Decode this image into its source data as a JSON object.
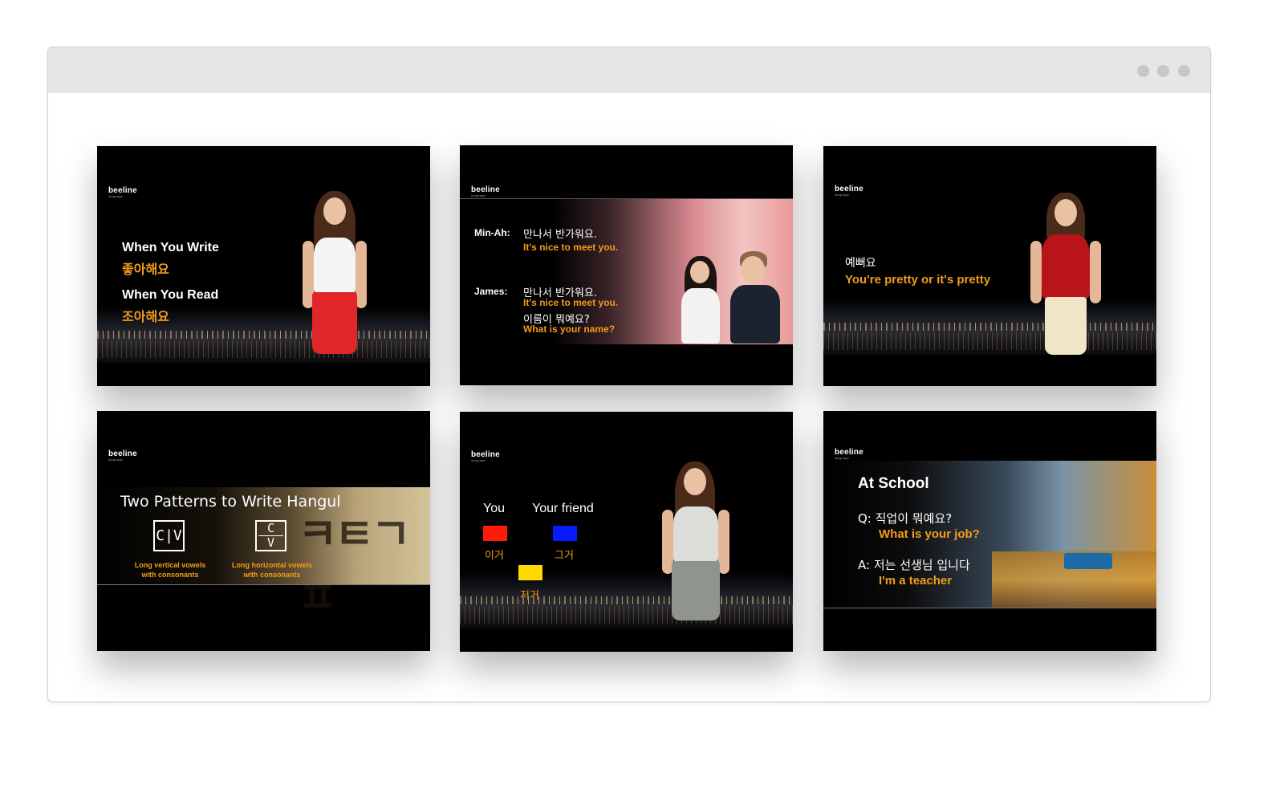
{
  "window": {
    "controls": [
      "dot",
      "dot",
      "dot"
    ]
  },
  "slides": [
    {
      "logo": "beeline",
      "logo_sub": "language",
      "line1": "When You Write",
      "line2": "좋아해요",
      "line3": "When You Read",
      "line4": "조아해요"
    },
    {
      "logo": "beeline",
      "logo_sub": "language",
      "speaker1": "Min-Ah:",
      "speaker1_ko": "만나서 반가워요.",
      "speaker1_en": "It's nice to meet you.",
      "speaker2": "James:",
      "speaker2_ko1": "만나서 반가워요.",
      "speaker2_en1": "It's nice to meet you.",
      "speaker2_ko2": "이름이 뭐예요?",
      "speaker2_en2": "What is your name?"
    },
    {
      "logo": "beeline",
      "logo_sub": "language",
      "korean": "예뻐요",
      "english": "You're pretty or it's pretty"
    },
    {
      "logo": "beeline",
      "logo_sub": "language",
      "title": "Two Patterns to Write Hangul",
      "box1": "C|V",
      "box1_caption_1": "Long vertical vowels",
      "box1_caption_2": "with consonants",
      "box2_top": "C",
      "box2_bottom": "V",
      "box2_caption_1": "Long horizontal vowels",
      "box2_caption_2": "with consonants"
    },
    {
      "logo": "beeline",
      "logo_sub": "language",
      "label_you": "You",
      "label_friend": "Your friend",
      "word_red": "이거",
      "word_blue": "그거",
      "word_yellow": "저거",
      "colors": {
        "red": "#ff1a0a",
        "blue": "#0a1aff",
        "yellow": "#ffd800"
      }
    },
    {
      "logo": "beeline",
      "logo_sub": "language",
      "title": "At School",
      "q_ko": "Q: 직업이 뭐예요?",
      "q_en": "What is your job?",
      "a_ko": "A: 저는 선생님 입니다",
      "a_en": "I'm a teacher"
    }
  ],
  "accent_color": "#f39c1b"
}
